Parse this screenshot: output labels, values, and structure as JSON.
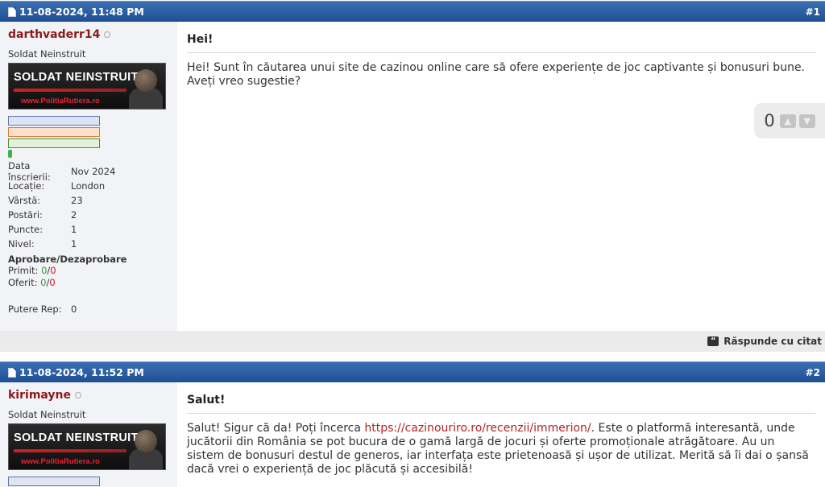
{
  "posts": [
    {
      "date": "11-08-2024, 11:48 PM",
      "number": "#1",
      "username": "darthvaderr14",
      "user_title": "Soldat Neinstruit",
      "rank_banner_title": "SOLDAT NEINSTRUIT",
      "rank_banner_url": "www.PolitiaRutiera.ro",
      "stats": [
        {
          "label": "Data înscrierii:",
          "value": "Nov 2024"
        },
        {
          "label": "Locație:",
          "value": "London"
        },
        {
          "label": "Vârstă:",
          "value": "23"
        },
        {
          "label": "Postări:",
          "value": "2"
        },
        {
          "label": "Puncte:",
          "value": "1"
        },
        {
          "label": "Nivel:",
          "value": "1"
        }
      ],
      "approval_heading": "Aprobare/Dezaprobare",
      "received_label": "Primit:",
      "received_pos": "0",
      "received_neg": "0",
      "given_label": "Oferit:",
      "given_pos": "0",
      "given_neg": "0",
      "rep_label": "Putere Rep:",
      "rep_value": "0",
      "title": "Hei!",
      "message": "Hei! Sunt în căutarea unui site de cazinou online care să ofere experiențe de joc captivante și bonusuri bune. Aveți vreo sugestie?",
      "thanks_count": "0",
      "reply_label": "Răspunde cu citat"
    },
    {
      "date": "11-08-2024, 11:52 PM",
      "number": "#2",
      "username": "kirimayne",
      "user_title": "Soldat Neinstruit",
      "rank_banner_title": "SOLDAT NEINSTRUIT",
      "rank_banner_url": "www.PolitiaRutiera.ro",
      "title": "Salut!",
      "message_before": "Salut! Sigur că da! Poți încerca ",
      "message_link": "https://cazinouriro.ro/recenzii/immerion/",
      "message_after": ". Este o platformă interesantă, unde jucătorii din România se pot bucura de o gamă largă de jocuri și oferte promoționale atrăgătoare. Au un sistem de bonusuri destul de generos, iar interfața este prietenoasă și ușor de utilizat. Merită să îi dai o șansă dacă vrei o experiență de joc plăcută și accesibilă!"
    }
  ]
}
